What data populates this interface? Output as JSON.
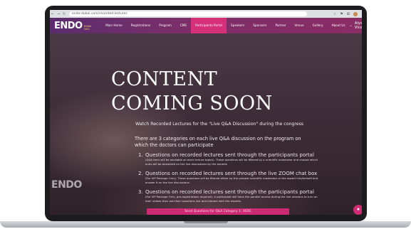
{
  "browser": {
    "back": "←",
    "forward": "→",
    "reload": "↻",
    "url": "endo-dubai.com/recorded-lectures",
    "icons": [
      "☆",
      "⚑",
      "⊞"
    ]
  },
  "header": {
    "logo_word": "ENDO",
    "logo_sub1": "DUBAI",
    "logo_sub2": "2021",
    "menu": [
      "Main Home",
      "Registrations",
      "Program",
      "CME",
      "Participants Portal",
      "Speakers",
      "Sponsors",
      "Partner",
      "Venue",
      "Gallery",
      "About Us"
    ],
    "active_menu": "Participants Portal",
    "user_name": "Alyssa Vicerol",
    "chevron": "⌄"
  },
  "hero": {
    "title_line1": "CONTENT",
    "title_line2": "COMING SOON",
    "intro": "Watch Recorded Lectures for the \"Live Q&A Discussion\" during the congress",
    "categories_text": "There are 3 categories on each live Q&A discussion on the program on which the doctors can participate",
    "categories": [
      {
        "num": "1.",
        "title": "Questions on recorded lectures sent through the participants portal",
        "note": "(Q&A form will be available on each lecture topics). These questions will be filtered by a scientific moderator and choose which ones will be answered on the live discussions by the experts"
      },
      {
        "num": "2.",
        "title": "Questions on recorded lectures sent through the live ZOOM chat box",
        "note": "(For VIP Package Only). These questions will be filtered either by the present scientific moderator or the expert him/herself and answer it on the live discussions."
      },
      {
        "num": "3.",
        "title": "Questions on recorded lectures sent through the participants portal",
        "note": "(For VIP Package Only, pre-registrations required). A participant will have the parallel access during the live sessions to turn on their videos then ask their questions live and interact with the experts."
      }
    ],
    "send_button": "Send Questions for Q&A Category 1: HERE",
    "side_logo": "ENDO"
  },
  "chat": {
    "icon": "chat-bubble-icon",
    "glyph": "●"
  },
  "colors": {
    "accent": "#cc2a73",
    "header": "#7a2e6a"
  }
}
